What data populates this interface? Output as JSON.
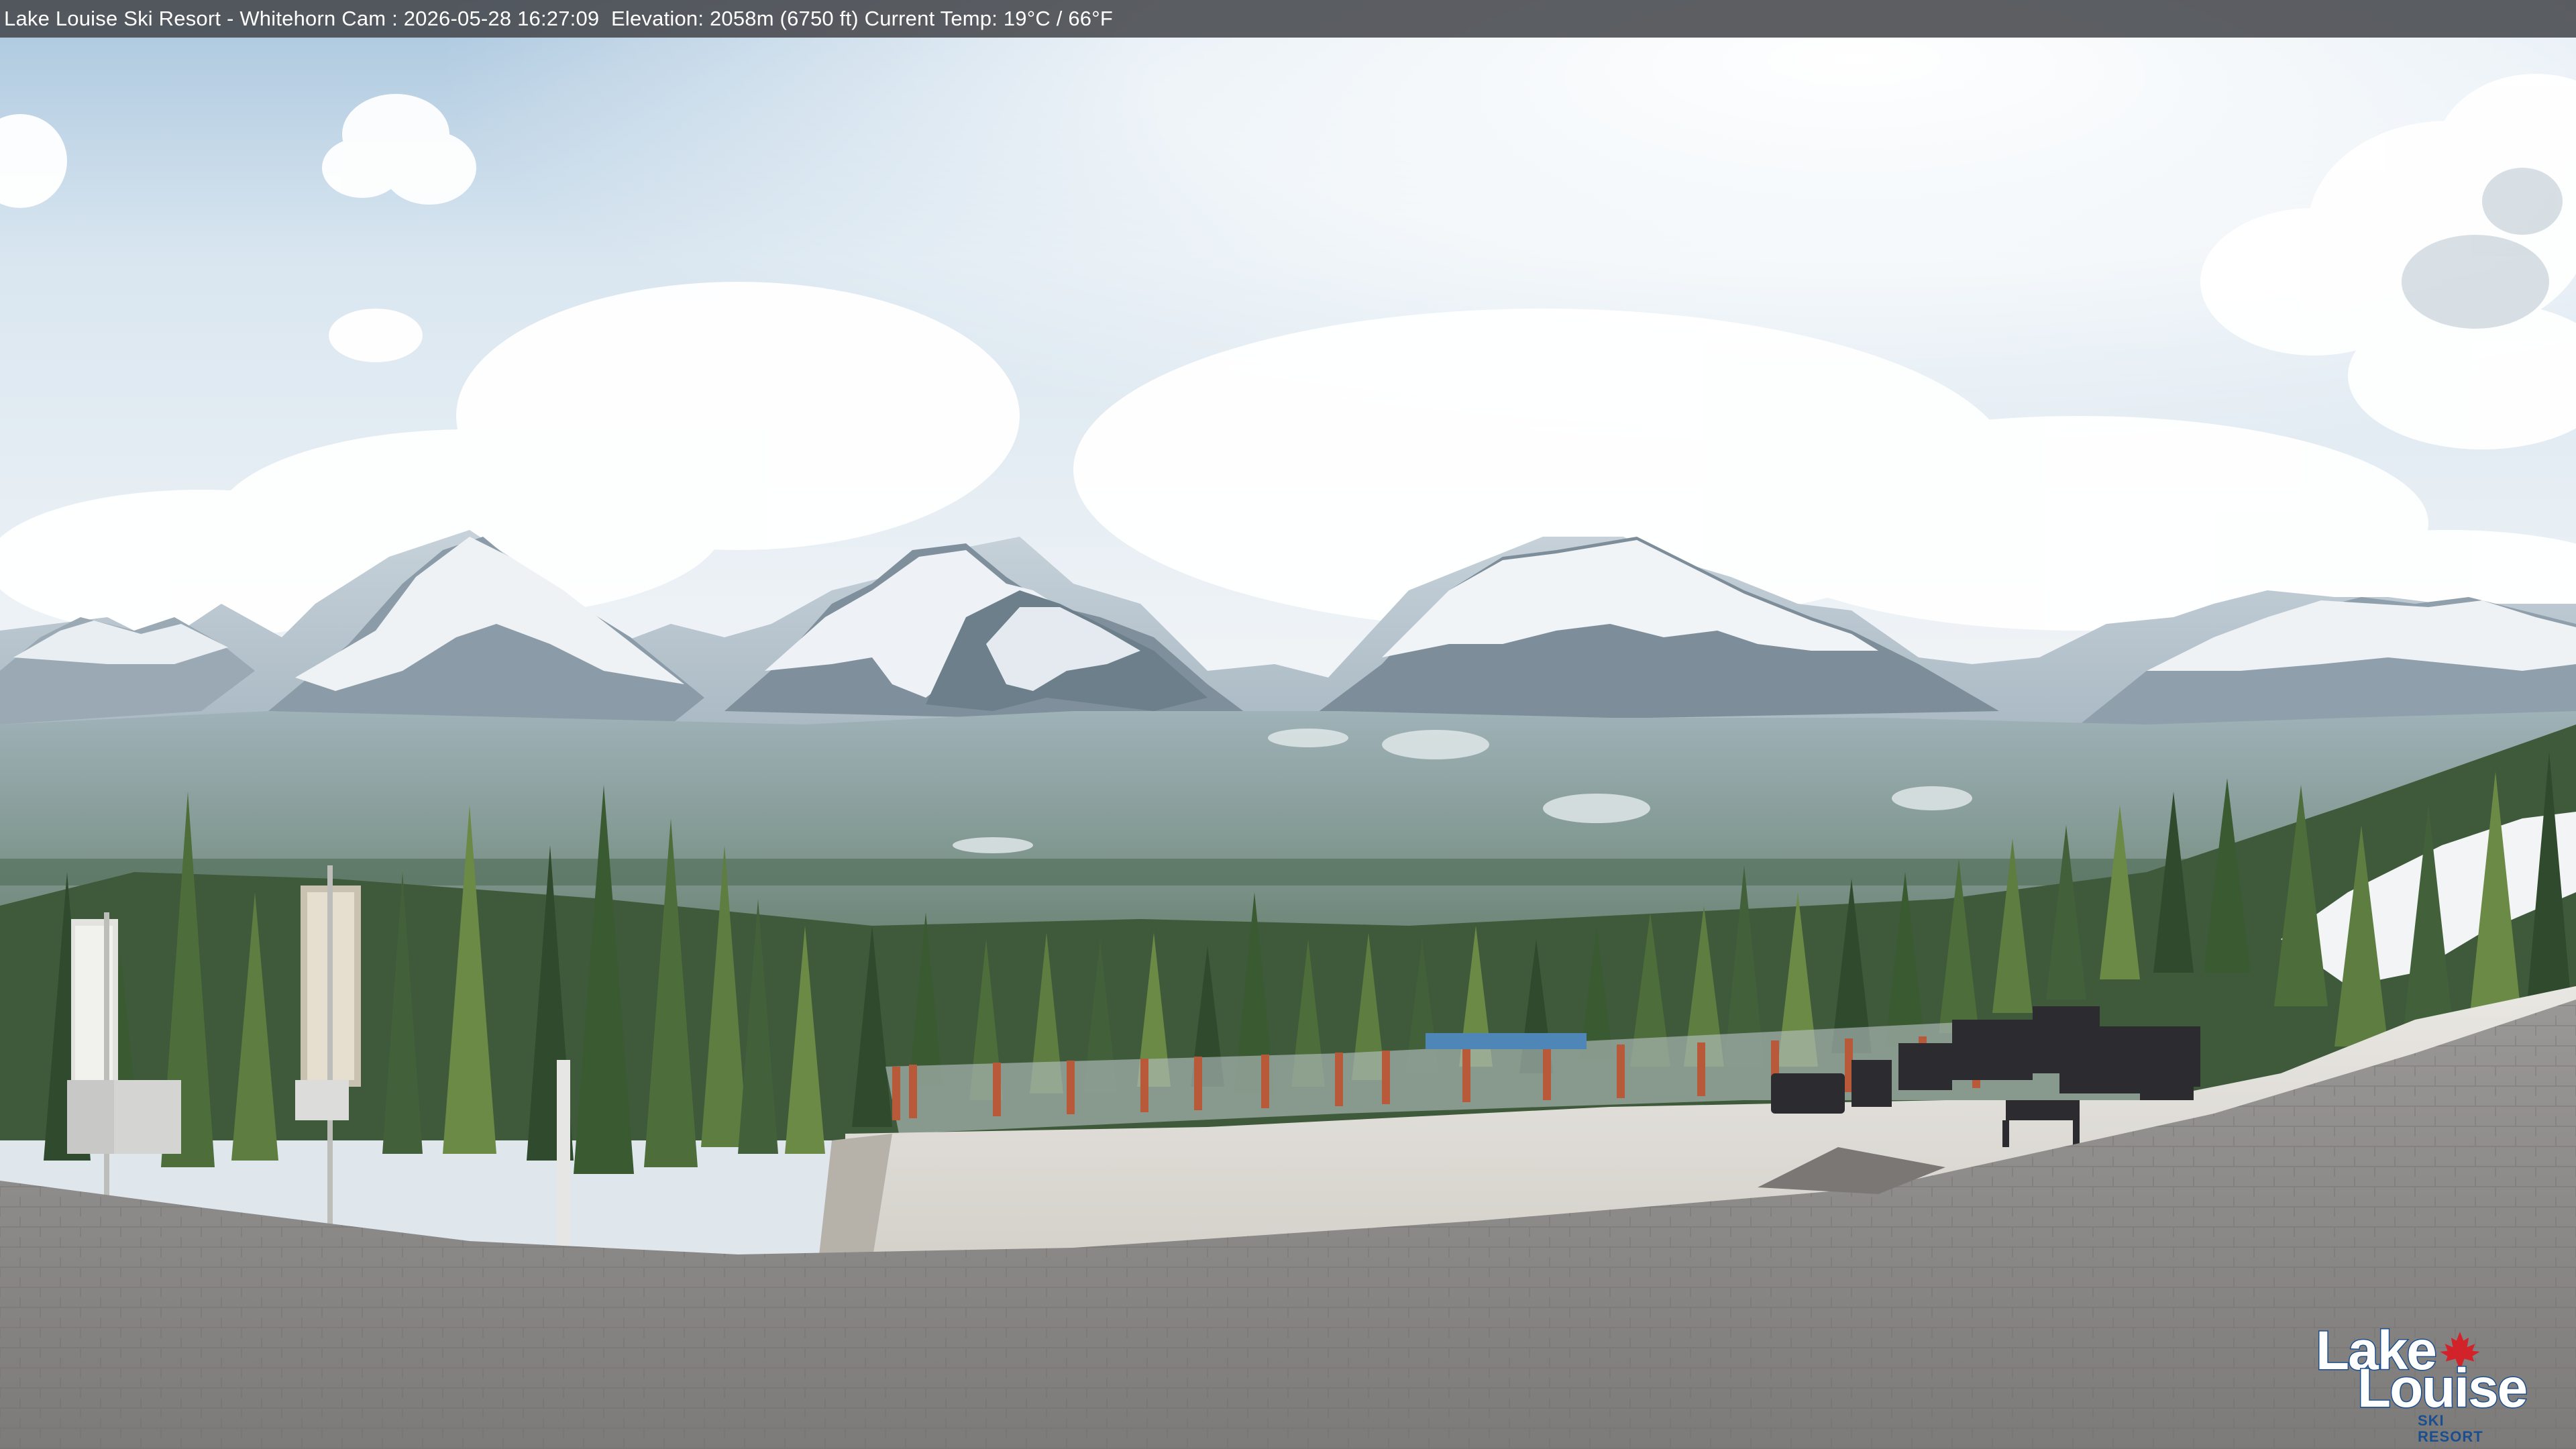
{
  "camera_overlay": {
    "text": "Lake Louise Ski Resort - Whitehorn Cam : 2026-05-28 16:27:09  Elevation: 2058m (6750 ft) Current Temp: 19°C / 66°F"
  },
  "logo": {
    "line1": "Lake",
    "line2": "Louise",
    "sub": "SKI RESORT",
    "icon": "maple-leaf-icon"
  },
  "colors": {
    "overlay_bar": "#46484c",
    "logo_blue": "#1a4e8f",
    "maple_leaf": "#d2232a"
  }
}
